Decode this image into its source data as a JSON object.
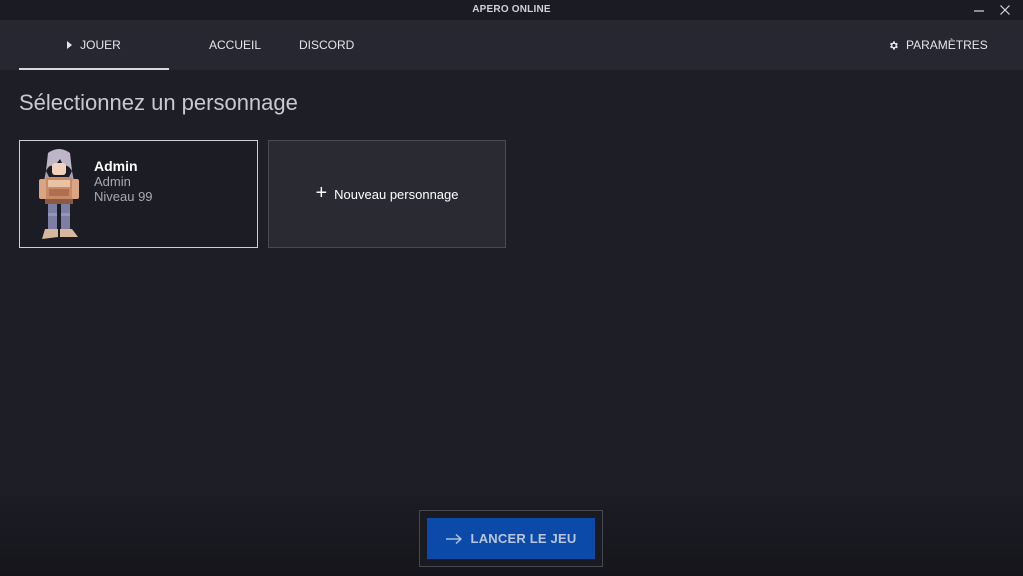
{
  "window": {
    "title": "APERO ONLINE"
  },
  "nav": {
    "play_label": "JOUER",
    "home_label": "ACCUEIL",
    "discord_label": "DISCORD",
    "settings_label": "PARAMÈTRES",
    "active_tab": "JOUER"
  },
  "main": {
    "title": "Sélectionnez un personnage",
    "characters": [
      {
        "name": "Admin",
        "class": "Admin",
        "level": "Niveau 99"
      }
    ],
    "new_character_label": "Nouveau personnage",
    "new_character_icon": "plus-icon"
  },
  "footer": {
    "launch_label": "LANCER LE JEU",
    "launch_icon": "arrow-right-icon"
  },
  "colors": {
    "background": "#1e1e27",
    "navbar": "#272731",
    "accent": "#0b4aa8"
  }
}
